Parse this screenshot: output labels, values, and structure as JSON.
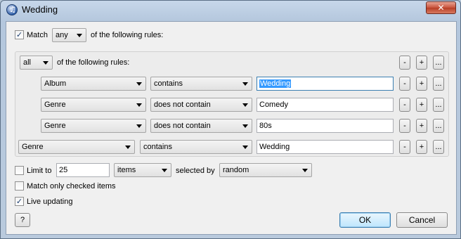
{
  "window": {
    "title": "Wedding",
    "close_label": "✕"
  },
  "match": {
    "checked": true,
    "label": "Match",
    "mode": "any",
    "suffix": "of the following rules:"
  },
  "group": {
    "mode": "all",
    "suffix": "of the following rules:",
    "rules": [
      {
        "field": "Album",
        "operator": "contains",
        "value": "Wedding"
      },
      {
        "field": "Genre",
        "operator": "does not contain",
        "value": "Comedy"
      },
      {
        "field": "Genre",
        "operator": "does not contain",
        "value": "80s"
      }
    ]
  },
  "outer_rule": {
    "field": "Genre",
    "operator": "contains",
    "value": "Wedding"
  },
  "rule_buttons": {
    "remove": "-",
    "add": "+",
    "more": "..."
  },
  "limit": {
    "checked": false,
    "label": "Limit to",
    "value": "25",
    "unit": "items",
    "selected_by_label": "selected by",
    "selected_by": "random"
  },
  "match_checked": {
    "checked": false,
    "label": "Match only checked items"
  },
  "live_updating": {
    "checked": true,
    "label": "Live updating"
  },
  "buttons": {
    "help": "?",
    "ok": "OK",
    "cancel": "Cancel"
  }
}
